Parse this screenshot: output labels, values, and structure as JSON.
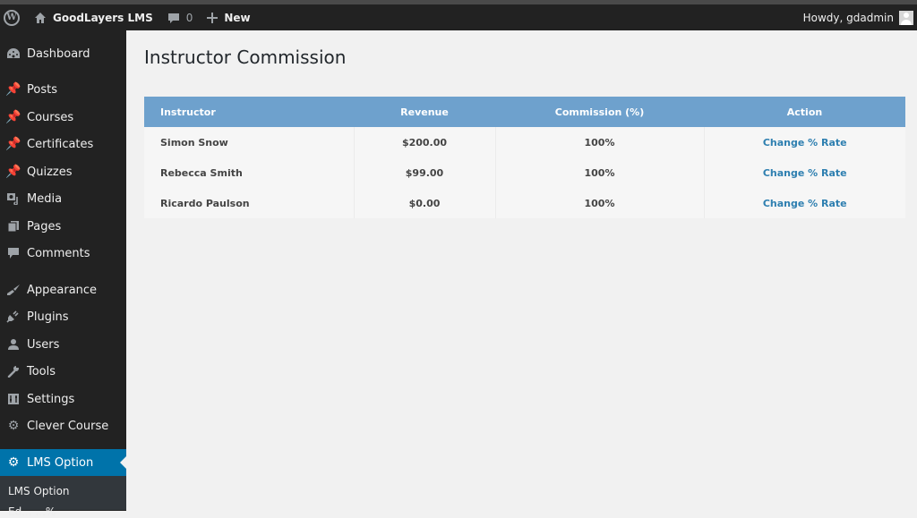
{
  "admin_bar": {
    "wp_logo": "W",
    "site_name": "GoodLayers LMS",
    "comments_count": "0",
    "new_label": "New",
    "howdy": "Howdy, gdadmin"
  },
  "sidebar": {
    "items": [
      {
        "label": "Dashboard",
        "icon": "dashboard-icon"
      },
      {
        "label": "Posts",
        "icon": "pin-icon"
      },
      {
        "label": "Courses",
        "icon": "pin-icon"
      },
      {
        "label": "Certificates",
        "icon": "pin-icon"
      },
      {
        "label": "Quizzes",
        "icon": "pin-icon"
      },
      {
        "label": "Media",
        "icon": "media-icon"
      },
      {
        "label": "Pages",
        "icon": "pages-icon"
      },
      {
        "label": "Comments",
        "icon": "comment-icon"
      },
      {
        "label": "Appearance",
        "icon": "brush-icon"
      },
      {
        "label": "Plugins",
        "icon": "plug-icon"
      },
      {
        "label": "Users",
        "icon": "user-icon"
      },
      {
        "label": "Tools",
        "icon": "wrench-icon"
      },
      {
        "label": "Settings",
        "icon": "settings-icon"
      },
      {
        "label": "Clever Course",
        "icon": "gear-icon"
      },
      {
        "label": "LMS Option",
        "icon": "gear-icon",
        "active": true
      }
    ],
    "submenu": [
      {
        "label": "LMS Option"
      },
      {
        "label": "Ed...  ...%"
      }
    ]
  },
  "main": {
    "title": "Instructor Commission",
    "table": {
      "headers": [
        "Instructor",
        "Revenue",
        "Commission (%)",
        "Action"
      ],
      "rows": [
        {
          "instructor": "Simon Snow",
          "revenue": "$200.00",
          "commission": "100%",
          "action": "Change % Rate"
        },
        {
          "instructor": "Rebecca Smith",
          "revenue": "$99.00",
          "commission": "100%",
          "action": "Change % Rate"
        },
        {
          "instructor": "Ricardo Paulson",
          "revenue": "$0.00",
          "commission": "100%",
          "action": "Change % Rate"
        }
      ]
    }
  },
  "colors": {
    "admin_bar_bg": "#222222",
    "sidebar_active": "#0073aa",
    "table_header": "#6ea1cd",
    "link": "#2e7fb0"
  }
}
